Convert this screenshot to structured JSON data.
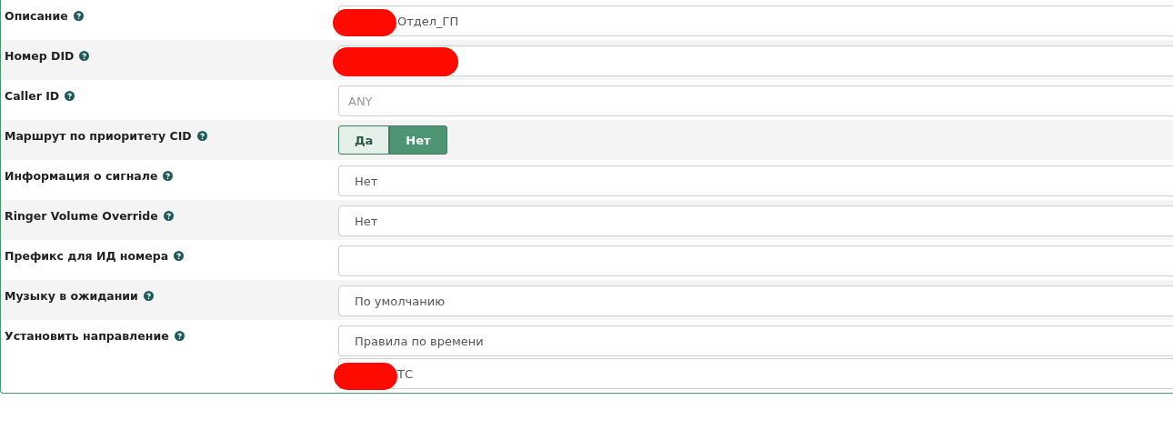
{
  "rows": [
    {
      "label": "Описание",
      "fields": [
        {
          "kind": "text",
          "value": "Отдел_ГП",
          "redacted": true
        }
      ]
    },
    {
      "label": "Номер DID",
      "fields": [
        {
          "kind": "text",
          "redacted": true
        }
      ]
    },
    {
      "label": "Caller ID",
      "fields": [
        {
          "kind": "text",
          "placeholder": "ANY"
        }
      ]
    },
    {
      "label": "Маршрут по приоритету CID",
      "fields": [
        {
          "kind": "toggle",
          "options": [
            {
              "label": "Да",
              "selected": false
            },
            {
              "label": "Нет",
              "selected": true
            }
          ]
        }
      ]
    },
    {
      "label": "Информация о сигнале",
      "fields": [
        {
          "kind": "select",
          "value": "Нет"
        }
      ]
    },
    {
      "label": "Ringer Volume Override",
      "fields": [
        {
          "kind": "select",
          "value": "Нет"
        }
      ]
    },
    {
      "label": "Префикс для ИД номера",
      "fields": [
        {
          "kind": "text"
        }
      ]
    },
    {
      "label": "Музыку в ожидании",
      "fields": [
        {
          "kind": "select",
          "value": "По умолчанию"
        }
      ]
    },
    {
      "label": "Установить направление",
      "fields": [
        {
          "kind": "select",
          "value": "Правила по времени"
        },
        {
          "kind": "select",
          "value": "ТС",
          "redacted": true
        }
      ]
    }
  ]
}
